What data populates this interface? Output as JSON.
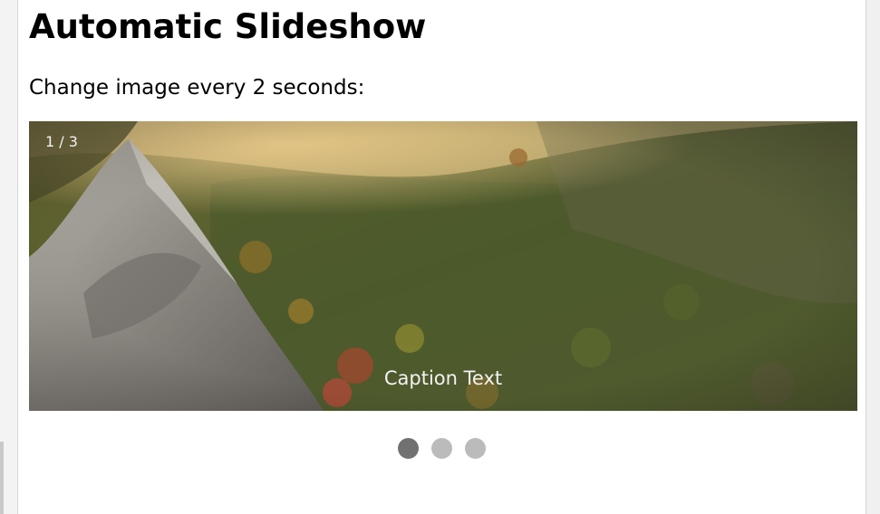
{
  "page": {
    "title": "Automatic Slideshow",
    "intro": "Change image every 2 seconds:"
  },
  "slideshow": {
    "current_slide": 1,
    "total_slides": 3,
    "number_text": "1 / 3",
    "caption": "Caption Text",
    "image_subject": "mountain-forest-landscape",
    "dots": [
      {
        "active": true
      },
      {
        "active": false
      },
      {
        "active": false
      }
    ]
  },
  "colors": {
    "dot_active": "#717171",
    "dot_inactive": "#bbbbbb",
    "overlay_text": "#f2f2f2"
  }
}
